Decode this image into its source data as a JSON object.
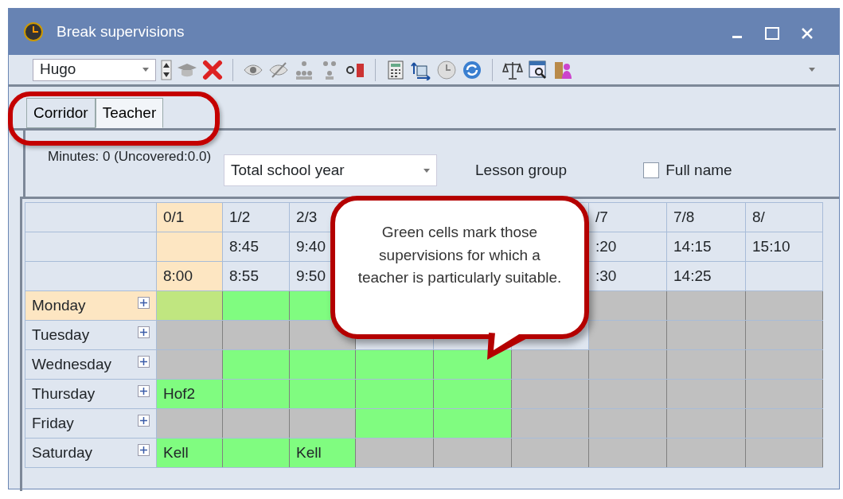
{
  "window": {
    "title": "Break supervisions"
  },
  "toolbar": {
    "teacher_select": "Hugo"
  },
  "tabs": [
    {
      "label": "Corridor",
      "selected": false
    },
    {
      "label": "Teacher",
      "selected": true
    }
  ],
  "summary": "Minutes: 0 (Uncovered:0.0)",
  "period_select": "Total school year",
  "lesson_group": "Lesson group",
  "full_name": {
    "label": "Full name",
    "checked": false
  },
  "table": {
    "columns": [
      {
        "break": "0/1",
        "end": "8:00",
        "selected": true
      },
      {
        "break": "1/2",
        "start": "8:45",
        "end": "8:55",
        "selected": false
      },
      {
        "break": "2/3",
        "start": "9:40",
        "end": "9:50",
        "selected": false
      },
      null,
      null,
      null,
      {
        "break": "/7",
        "start": ":20",
        "end": ":30",
        "selected": false
      },
      {
        "break": "7/8",
        "start": "14:15",
        "end": "14:25",
        "selected": false
      },
      {
        "break": "8/",
        "start": "15:10",
        "selected": false
      }
    ],
    "rows": [
      {
        "day": "Monday",
        "selected": true,
        "cells": [
          {
            "color": "#c0e680"
          },
          {
            "color": "#80fc80"
          },
          {
            "color": "#80fc80"
          },
          null,
          null,
          null,
          {
            "color": "#c0c0c0"
          },
          {
            "color": "#c0c0c0"
          },
          {
            "color": "#c0c0c0"
          }
        ]
      },
      {
        "day": "Tuesday",
        "selected": false,
        "cells": [
          {
            "color": "#c0c0c0"
          },
          {
            "color": "#c0c0c0"
          },
          {
            "color": "#c0c0c0"
          },
          null,
          null,
          null,
          {
            "color": "#c0c0c0"
          },
          {
            "color": "#c0c0c0"
          },
          {
            "color": "#c0c0c0"
          }
        ]
      },
      {
        "day": "Wednesday",
        "selected": false,
        "cells": [
          {
            "color": "#c0c0c0"
          },
          {
            "color": "#80fc80"
          },
          {
            "color": "#80fc80"
          },
          {
            "color": "#80fc80"
          },
          {
            "color": "#80fc80"
          },
          {
            "color": "#c0c0c0"
          },
          {
            "color": "#c0c0c0"
          },
          {
            "color": "#c0c0c0"
          },
          {
            "color": "#c0c0c0"
          }
        ]
      },
      {
        "day": "Thursday",
        "selected": false,
        "cells": [
          {
            "color": "#80fc80",
            "text": "Hof2"
          },
          {
            "color": "#80fc80"
          },
          {
            "color": "#80fc80"
          },
          {
            "color": "#80fc80"
          },
          {
            "color": "#80fc80"
          },
          {
            "color": "#c0c0c0"
          },
          {
            "color": "#c0c0c0"
          },
          {
            "color": "#c0c0c0"
          },
          {
            "color": "#c0c0c0"
          }
        ]
      },
      {
        "day": "Friday",
        "selected": false,
        "cells": [
          {
            "color": "#c0c0c0"
          },
          {
            "color": "#c0c0c0"
          },
          {
            "color": "#c0c0c0"
          },
          {
            "color": "#80fc80"
          },
          {
            "color": "#80fc80"
          },
          {
            "color": "#c0c0c0"
          },
          {
            "color": "#c0c0c0"
          },
          {
            "color": "#c0c0c0"
          },
          {
            "color": "#c0c0c0"
          }
        ]
      },
      {
        "day": "Saturday",
        "selected": false,
        "cells": [
          {
            "color": "#80fc80",
            "text": "Kell"
          },
          {
            "color": "#80fc80"
          },
          {
            "color": "#80fc80",
            "text": "Kell"
          },
          {
            "color": "#c0c0c0"
          },
          {
            "color": "#c0c0c0"
          },
          {
            "color": "#c0c0c0"
          },
          {
            "color": "#c0c0c0"
          },
          {
            "color": "#c0c0c0"
          },
          {
            "color": "#c0c0c0"
          }
        ]
      }
    ]
  },
  "callout": {
    "text": "Green cells mark those supervisions for which a teacher is particularly suitable."
  }
}
